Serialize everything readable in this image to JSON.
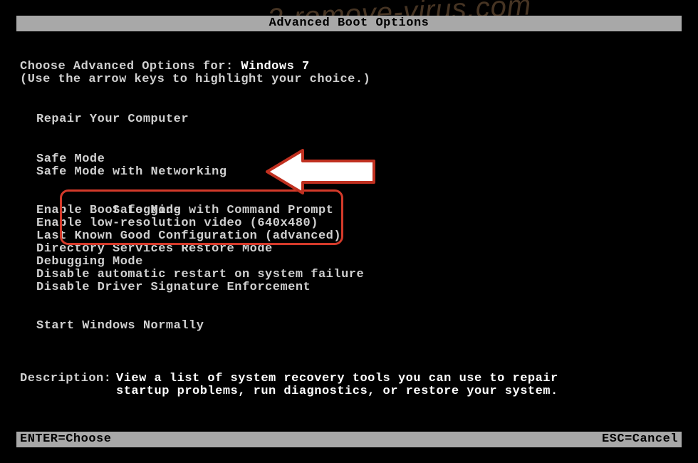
{
  "watermark": "2-remove-virus.com",
  "title": "Advanced Boot Options",
  "header": {
    "prefix": "Choose Advanced Options for: ",
    "os": "Windows 7",
    "hint": "(Use the arrow keys to highlight your choice.)"
  },
  "menu": {
    "group1": [
      "Repair Your Computer"
    ],
    "group2": [
      "Safe Mode",
      "Safe Mode with Networking",
      "Safe Mode with Command Prompt"
    ],
    "group3": [
      "Enable Boot Logging",
      "Enable low-resolution video (640x480)",
      "Last Known Good Configuration (advanced)",
      "Directory Services Restore Mode",
      "Debugging Mode",
      "Disable automatic restart on system failure",
      "Disable Driver Signature Enforcement"
    ],
    "group4": [
      "Start Windows Normally"
    ]
  },
  "description": {
    "label": "Description:",
    "line1": "View a list of system recovery tools you can use to repair",
    "line2": "startup problems, run diagnostics, or restore your system."
  },
  "footer": {
    "left": "ENTER=Choose",
    "right": "ESC=Cancel"
  },
  "highlight_color": "#d43a2a"
}
